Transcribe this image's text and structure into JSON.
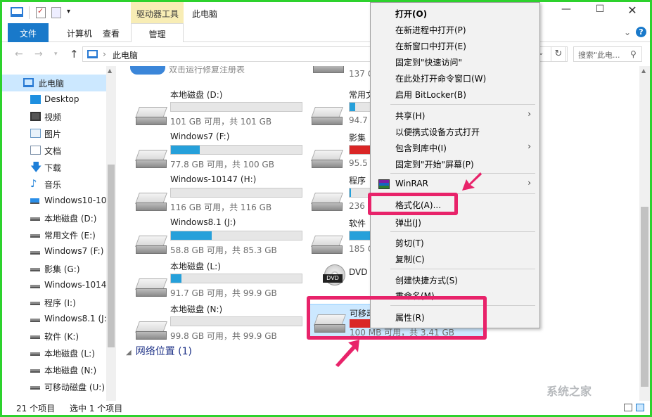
{
  "titlebar": {
    "drive_tools": "驱动器工具",
    "title": "此电脑",
    "min": "—",
    "max": "☐",
    "close": "✕"
  },
  "ribbon": {
    "tabs": [
      "文件",
      "计算机",
      "查看",
      "管理"
    ],
    "expand_icon": "⌄",
    "help_icon": "?"
  },
  "address": {
    "path": "此电脑",
    "search_placeholder": "搜索\"此电...",
    "refresh": "↻"
  },
  "nav": {
    "items": [
      {
        "label": "此电脑",
        "icon": "computer-icon"
      },
      {
        "label": "Desktop",
        "icon": "desktop-icon"
      },
      {
        "label": "视频",
        "icon": "video-icon"
      },
      {
        "label": "图片",
        "icon": "pictures-icon"
      },
      {
        "label": "文档",
        "icon": "documents-icon"
      },
      {
        "label": "下载",
        "icon": "download-icon"
      },
      {
        "label": "音乐",
        "icon": "music-icon"
      },
      {
        "label": "Windows10-10",
        "icon": "windows-drive-icon"
      },
      {
        "label": "本地磁盘 (D:)",
        "icon": "drive-icon"
      },
      {
        "label": "常用文件 (E:)",
        "icon": "drive-icon"
      },
      {
        "label": "Windows7 (F:)",
        "icon": "drive-icon"
      },
      {
        "label": "影集 (G:)",
        "icon": "drive-icon"
      },
      {
        "label": "Windows-1014",
        "icon": "drive-icon"
      },
      {
        "label": "程序 (I:)",
        "icon": "drive-icon"
      },
      {
        "label": "Windows8.1 (J:",
        "icon": "drive-icon"
      },
      {
        "label": "软件 (K:)",
        "icon": "drive-icon"
      },
      {
        "label": "本地磁盘 (L:)",
        "icon": "drive-icon"
      },
      {
        "label": "本地磁盘 (N:)",
        "icon": "drive-icon"
      },
      {
        "label": "可移动磁盘 (U:)",
        "icon": "drive-icon"
      }
    ]
  },
  "content": {
    "top_partial_text": "双击运行修复注册表",
    "top_right_text": "137 G",
    "drives_left": [
      {
        "name": "本地磁盘 (D:)",
        "free": "101 GB 可用，共 101 GB",
        "used_fraction": 0.0
      },
      {
        "name": "Windows7 (F:)",
        "free": "77.8 GB 可用，共 100 GB",
        "used_fraction": 0.22
      },
      {
        "name": "Windows-10147 (H:)",
        "free": "116 GB 可用，共 116 GB",
        "used_fraction": 0.0
      },
      {
        "name": "Windows8.1 (J:)",
        "free": "58.8 GB 可用，共 85.3 GB",
        "used_fraction": 0.31
      },
      {
        "name": "本地磁盘 (L:)",
        "free": "91.7 GB 可用，共 99.9 GB",
        "used_fraction": 0.08
      },
      {
        "name": "本地磁盘 (N:)",
        "free": "99.8 GB 可用，共 99.9 GB",
        "used_fraction": 0.0
      }
    ],
    "drives_right": [
      {
        "name": "常用文",
        "free": "94.7 G",
        "used_fraction": 0.2
      },
      {
        "name": "影集",
        "free": "95.5 G",
        "used_fraction": 0.8
      },
      {
        "name": "程序",
        "free": "236 G",
        "used_fraction": 0.05
      },
      {
        "name": "软件",
        "free": "185 G",
        "used_fraction": 1.0
      }
    ],
    "dvd": {
      "name": "DVD",
      "label": "DVD"
    },
    "usb": {
      "name": "可移动",
      "free": "100 MB 可用，共 3.41 GB",
      "used_fraction": 0.97
    },
    "network": "网络位置 (1)"
  },
  "status": {
    "count": "21 个项目",
    "selected": "选中 1 个项目"
  },
  "watermark": "系统之家",
  "menu": {
    "open": "打开(O)",
    "new_process": "在新进程中打开(P)",
    "new_window": "在新窗口中打开(E)",
    "pin_quick": "固定到\"快速访问\"",
    "cmd_here": "在此处打开命令窗口(W)",
    "bitlocker": "启用 BitLocker(B)",
    "share": "共享(H)",
    "portable": "以便携式设备方式打开",
    "include_lib": "包含到库中(I)",
    "pin_start": "固定到\"开始\"屏幕(P)",
    "winrar": "WinRAR",
    "format": "格式化(A)...",
    "eject": "弹出(J)",
    "cut": "剪切(T)",
    "copy": "复制(C)",
    "shortcut": "创建快捷方式(S)",
    "rename": "重命名(M)",
    "properties": "属性(R)"
  },
  "colors": {
    "accent": "#1979ca",
    "highlight": "#e8236a",
    "frame": "#2dd22d",
    "bar_fill": "#26a0da",
    "bar_full": "#da2626"
  }
}
